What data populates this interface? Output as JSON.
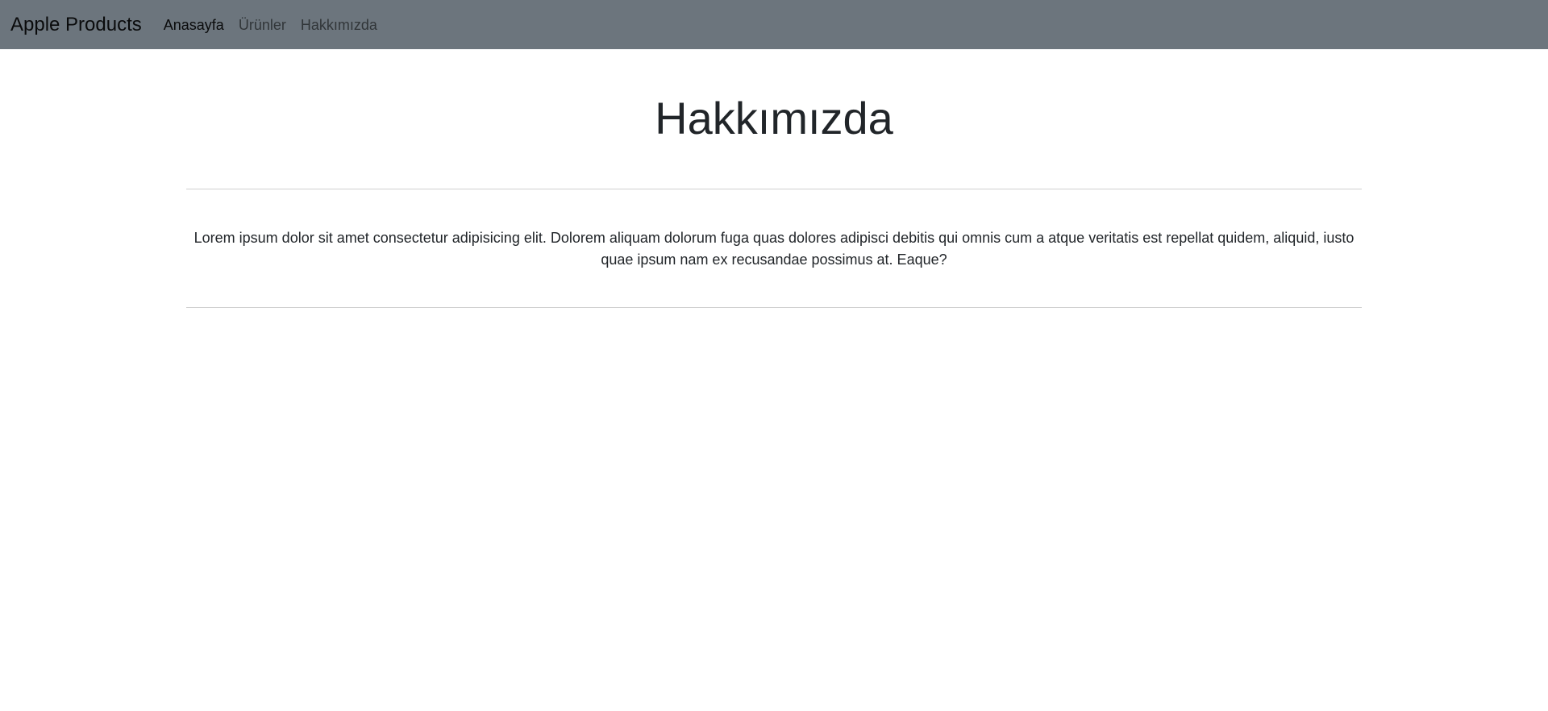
{
  "navbar": {
    "brand": "Apple Products",
    "links": [
      {
        "label": "Anasayfa",
        "active": true
      },
      {
        "label": "Ürünler",
        "active": false
      },
      {
        "label": "Hakkımızda",
        "active": false
      }
    ],
    "background_color": "#6c757d"
  },
  "main": {
    "title": "Hakkımızda",
    "paragraph": "Lorem ipsum dolor sit amet consectetur adipisicing elit. Dolorem aliquam dolorum fuga quas dolores adipisci debitis qui omnis cum a atque veritatis est repellat quidem, aliquid, iusto quae ipsum nam ex recusandae possimus at. Eaque?"
  }
}
